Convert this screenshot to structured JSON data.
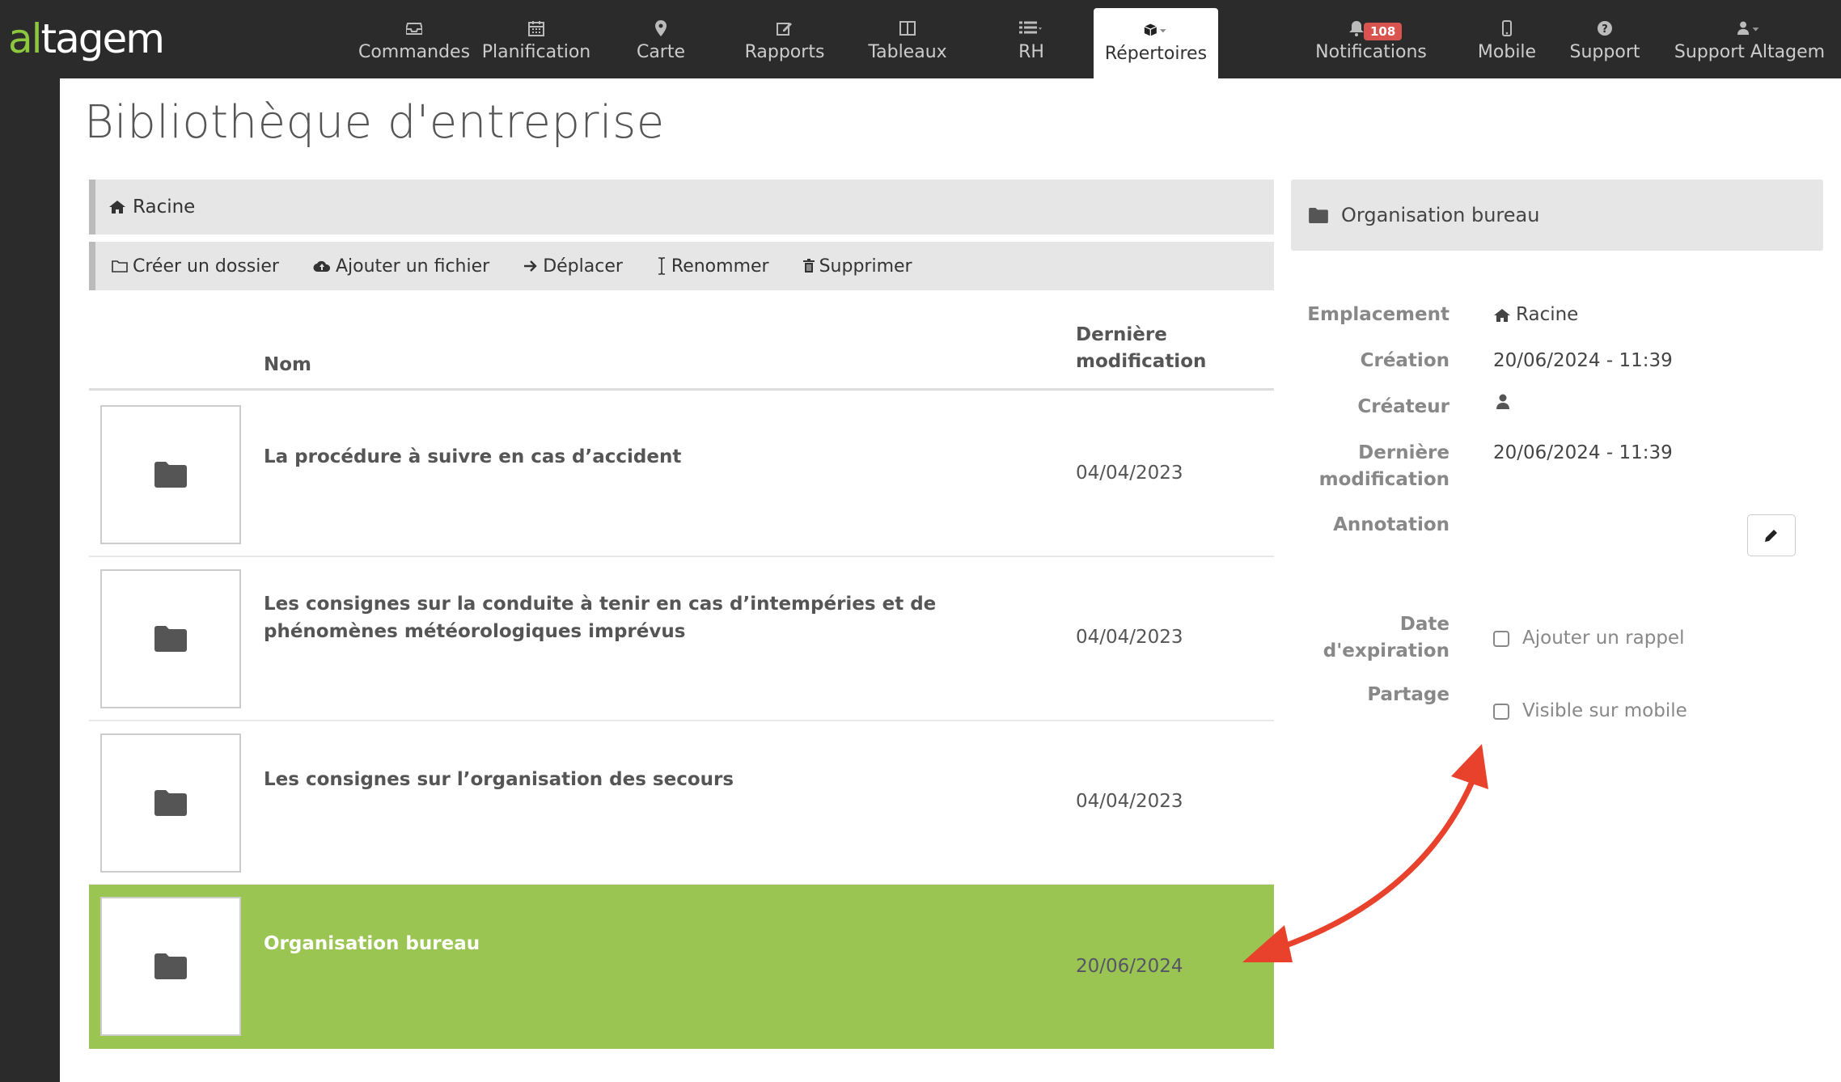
{
  "brand": {
    "logo_first": "al",
    "logo_rest": "tagem"
  },
  "nav": {
    "items": [
      {
        "label": "Commandes",
        "icon": "inbox-icon"
      },
      {
        "label": "Planification",
        "icon": "calendar-icon"
      },
      {
        "label": "Carte",
        "icon": "map-marker-icon"
      },
      {
        "label": "Rapports",
        "icon": "edit-icon"
      },
      {
        "label": "Tableaux",
        "icon": "columns-icon"
      },
      {
        "label": "RH",
        "icon": "list-icon"
      },
      {
        "label": "Répertoires",
        "icon": "cube-icon"
      }
    ],
    "right_items": [
      {
        "label": "Notifications",
        "icon": "bell-icon"
      },
      {
        "label": "Mobile",
        "icon": "mobile-icon"
      },
      {
        "label": "Support",
        "icon": "question-icon"
      },
      {
        "label": "Support Altagem",
        "icon": "user-icon"
      }
    ],
    "notification_count": "108"
  },
  "page": {
    "title": "Bibliothèque d'entreprise"
  },
  "breadcrumb": {
    "root": "Racine"
  },
  "toolbar": {
    "create_folder": "Créer un dossier",
    "add_file": "Ajouter un fichier",
    "move": "Déplacer",
    "rename": "Renommer",
    "delete": "Supprimer"
  },
  "table": {
    "col_name": "Nom",
    "col_date_line1": "Dernière",
    "col_date_line2": "modification",
    "rows": [
      {
        "name": "La procédure à suivre en cas d’accident",
        "date": "04/04/2023"
      },
      {
        "name": "Les consignes sur la conduite à tenir en cas d’intempéries et de phénomènes météorologiques imprévus",
        "date": "04/04/2023"
      },
      {
        "name": "Les consignes sur l’organisation des secours",
        "date": "04/04/2023"
      },
      {
        "name": "Organisation bureau",
        "date": "20/06/2024"
      }
    ]
  },
  "details": {
    "title": "Organisation bureau",
    "labels": {
      "location": "Emplacement",
      "creation": "Création",
      "creator": "Créateur",
      "modified_1": "Dernière",
      "modified_2": "modification",
      "annotation": "Annotation",
      "expiry_1": "Date",
      "expiry_2": "d'expiration",
      "sharing": "Partage"
    },
    "values": {
      "location": "Racine",
      "creation": "20/06/2024 - 11:39",
      "modified": "20/06/2024 - 11:39",
      "reminder": "Ajouter un rappel",
      "mobile": "Visible sur mobile"
    }
  },
  "colors": {
    "accent": "#9bc552",
    "nav_bg": "#2b2b2b",
    "badge": "#d9534f",
    "arrow": "#e8412c"
  }
}
